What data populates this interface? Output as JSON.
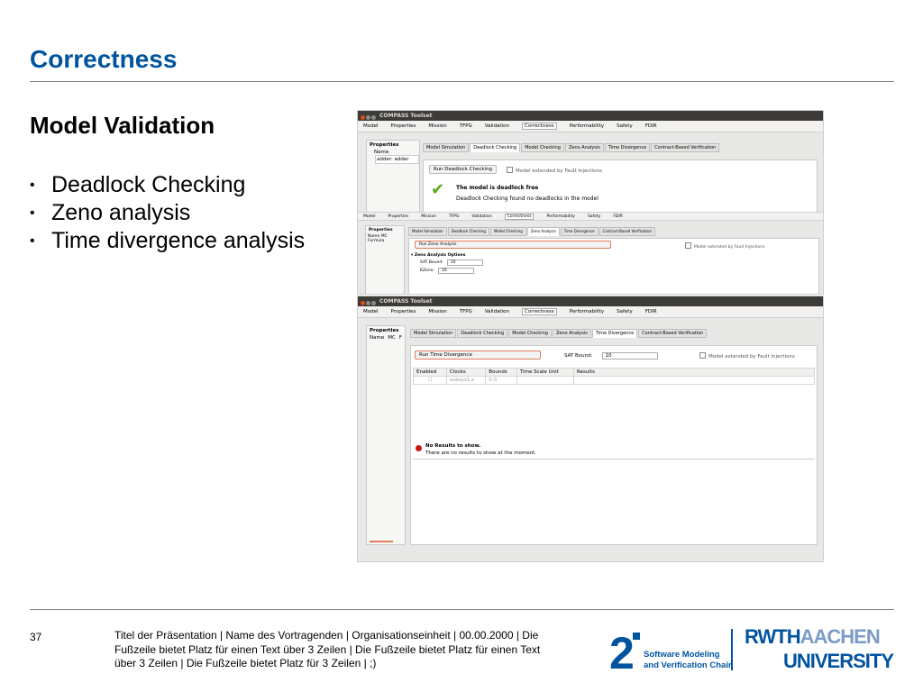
{
  "slide": {
    "title": "Correctness",
    "subtitle": "Model Validation",
    "bullets": [
      "Deadlock Checking",
      "Zeno analysis",
      "Time divergence analysis"
    ]
  },
  "footer": {
    "page_number": "37",
    "text": "Titel der Präsentation  |  Name des Vortragenden  |  Organisationseinheit  |  00.00.2000  |  Die Fußzeile bietet Platz für einen Text über 3 Zeilen  |  Die Fußzeile bietet Platz für einen Text über 3 Zeilen  |  Die Fußzeile bietet Platz für 3 Zeilen  | ;)",
    "logo2_line1": "Software Modeling",
    "logo2_line2": "and Verification Chair",
    "rwth_dark": "RWTH",
    "rwth_light": "AACHEN",
    "rwth_line2": "UNIVERSITY"
  },
  "colors": {
    "accent": "#00549f",
    "rule": "#7f7f7f",
    "ok": "#5aaa1f",
    "error": "#c8161d"
  },
  "screenshot1": {
    "window_title": "COMPASS Toolset",
    "menu": [
      "Model",
      "Properties",
      "Mission",
      "TFPG",
      "Validation",
      "Correctness",
      "Performability",
      "Safety",
      "FDIR"
    ],
    "active_menu": "Correctness",
    "properties_title": "Properties",
    "properties_col": "Name",
    "properties_item": "adder: adder",
    "tabs": [
      "Model Simulation",
      "Deadlock Checking",
      "Model Checking",
      "Zeno Analysis",
      "Time Divergence",
      "Contract-Based Verification"
    ],
    "run_button": "Run Deadlock Checking",
    "fault_checkbox": "Model extended by Fault Injections",
    "result_title": "The model is deadlock free",
    "result_text": "Deadlock Checking found no deadlocks in the model"
  },
  "screenshot2": {
    "menu": [
      "Model",
      "Properties",
      "Mission",
      "TFPG",
      "Validation",
      "Correctness",
      "Performability",
      "Safety",
      "FDIR"
    ],
    "properties_title": "Properties",
    "properties_cols": "Name  MC  Formula",
    "tabs": [
      "Model Simulation",
      "Deadlock Checking",
      "Model Checking",
      "Zeno Analysis",
      "Time Divergence",
      "Contract-Based Verification"
    ],
    "run_button": "Run Zeno Analysis",
    "fault_checkbox": "Model extended by Fault Injections",
    "options_title": "▾ Zeno Analysis Options",
    "sat_bound_label": "SAT Bound:",
    "sat_bound_value": "10",
    "kzeno_label": "KZeno:",
    "kzeno_value": "10"
  },
  "screenshot3": {
    "window_title": "COMPASS Toolset",
    "menu": [
      "Model",
      "Properties",
      "Mission",
      "TFPG",
      "Validation",
      "Correctness",
      "Performability",
      "Safety",
      "FDIR"
    ],
    "active_menu": "Correctness",
    "properties_title": "Properties",
    "properties_cols": [
      "Name",
      "MC",
      "F"
    ],
    "tabs": [
      "Model Simulation",
      "Deadlock Checking",
      "Model Checking",
      "Zeno Analysis",
      "Time Divergence",
      "Contract-Based Verification"
    ],
    "run_button": "Run Time Divergence",
    "sat_bound_label": "SAT Bound:",
    "sat_bound_value": "10",
    "fault_checkbox": "Model extended by Fault Injections",
    "table_headers": [
      "Enabled",
      "Clocks",
      "Bounds",
      "Time Scale Unit",
      "Results"
    ],
    "table_row": [
      "☐",
      "subsys1.x",
      "0.0",
      "",
      ""
    ],
    "no_results_title": "No Results to show.",
    "no_results_text": "There are no results to show at the moment."
  }
}
